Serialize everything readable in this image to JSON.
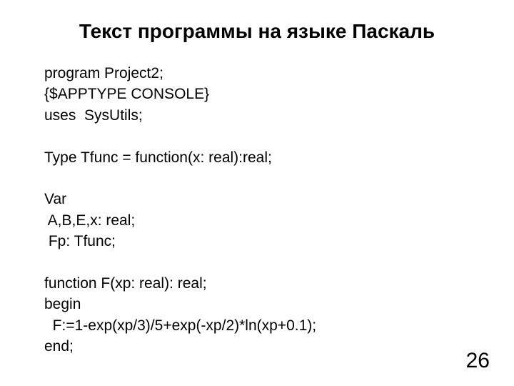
{
  "title": "Текст программы на языке Паскаль",
  "code": {
    "l1": "program Project2;",
    "l2": "{$APPTYPE CONSOLE}",
    "l3": "uses  SysUtils;",
    "l4": "",
    "l5": "Type Tfunc = function(x: real):real;",
    "l6": "",
    "l7": "Var",
    "l8": " A,B,E,x: real;",
    "l9": " Fp: Tfunc;",
    "l10": "",
    "l11": "function F(xp: real): real;",
    "l12": "begin",
    "l13": "  F:=1-exp(xp/3)/5+exp(-xp/2)*ln(xp+0.1);",
    "l14": "end;"
  },
  "page_number": "26"
}
